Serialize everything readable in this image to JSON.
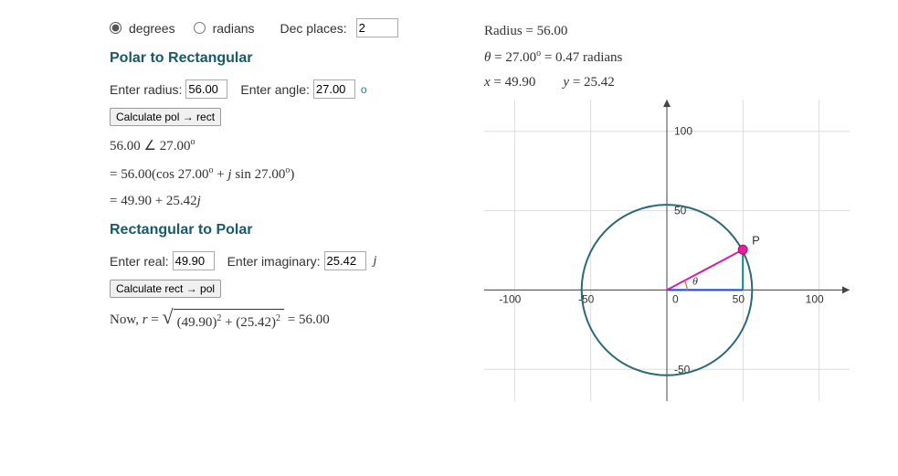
{
  "controls": {
    "degrees_label": "degrees",
    "radians_label": "radians",
    "dec_places_label": "Dec places:",
    "dec_places_value": "2"
  },
  "p2r": {
    "heading": "Polar to Rectangular",
    "enter_radius_label": "Enter radius:",
    "radius_value": "56.00",
    "enter_angle_label": "Enter angle:",
    "angle_value": "27.00",
    "angle_unit": "o",
    "button_label": "Calculate pol → rect",
    "line1_a": "56.00",
    "line1_b": "27.00",
    "line1_deg": "o",
    "line2": "= 56.00(cos 27.00",
    "line2_deg1": "o",
    "line2_mid": " + ",
    "line2_j": "j",
    "line2_sin": " sin 27.00",
    "line2_deg2": "o",
    "line2_close": ")",
    "line3_a": "= 49.90 + 25.42",
    "line3_j": "j"
  },
  "r2p": {
    "heading": "Rectangular to Polar",
    "enter_real_label": "Enter real:",
    "real_value": "49.90",
    "enter_imag_label": "Enter imaginary:",
    "imag_value": "25.42",
    "imag_unit": "j",
    "button_label": "Calculate rect → pol",
    "now_prefix": "Now, ",
    "now_r": "r",
    "now_eq": " = ",
    "sqrt_body_a": "(49.90)",
    "sqrt_exp": "2",
    "sqrt_plus": " + (25.42)",
    "result": " = 56.00"
  },
  "readout": {
    "radius_line": "Radius = 56.00",
    "theta_sym": "θ",
    "theta_line": " = 27.00",
    "theta_deg": "o",
    "theta_rad": " = 0.47 radians",
    "x_sym": "x",
    "x_line": " = 49.90",
    "y_sym": "y",
    "y_line": " = 25.42"
  },
  "chart_data": {
    "type": "scatter",
    "title": "",
    "xlim": [
      -120,
      120
    ],
    "ylim": [
      -70,
      120
    ],
    "ticks_x": [
      -100,
      -50,
      0,
      50,
      100
    ],
    "ticks_y": [
      -50,
      50,
      100
    ],
    "circle_radius": 56.0,
    "point": {
      "x": 49.9,
      "y": 25.42,
      "label": "P"
    },
    "angle_label": "θ"
  }
}
